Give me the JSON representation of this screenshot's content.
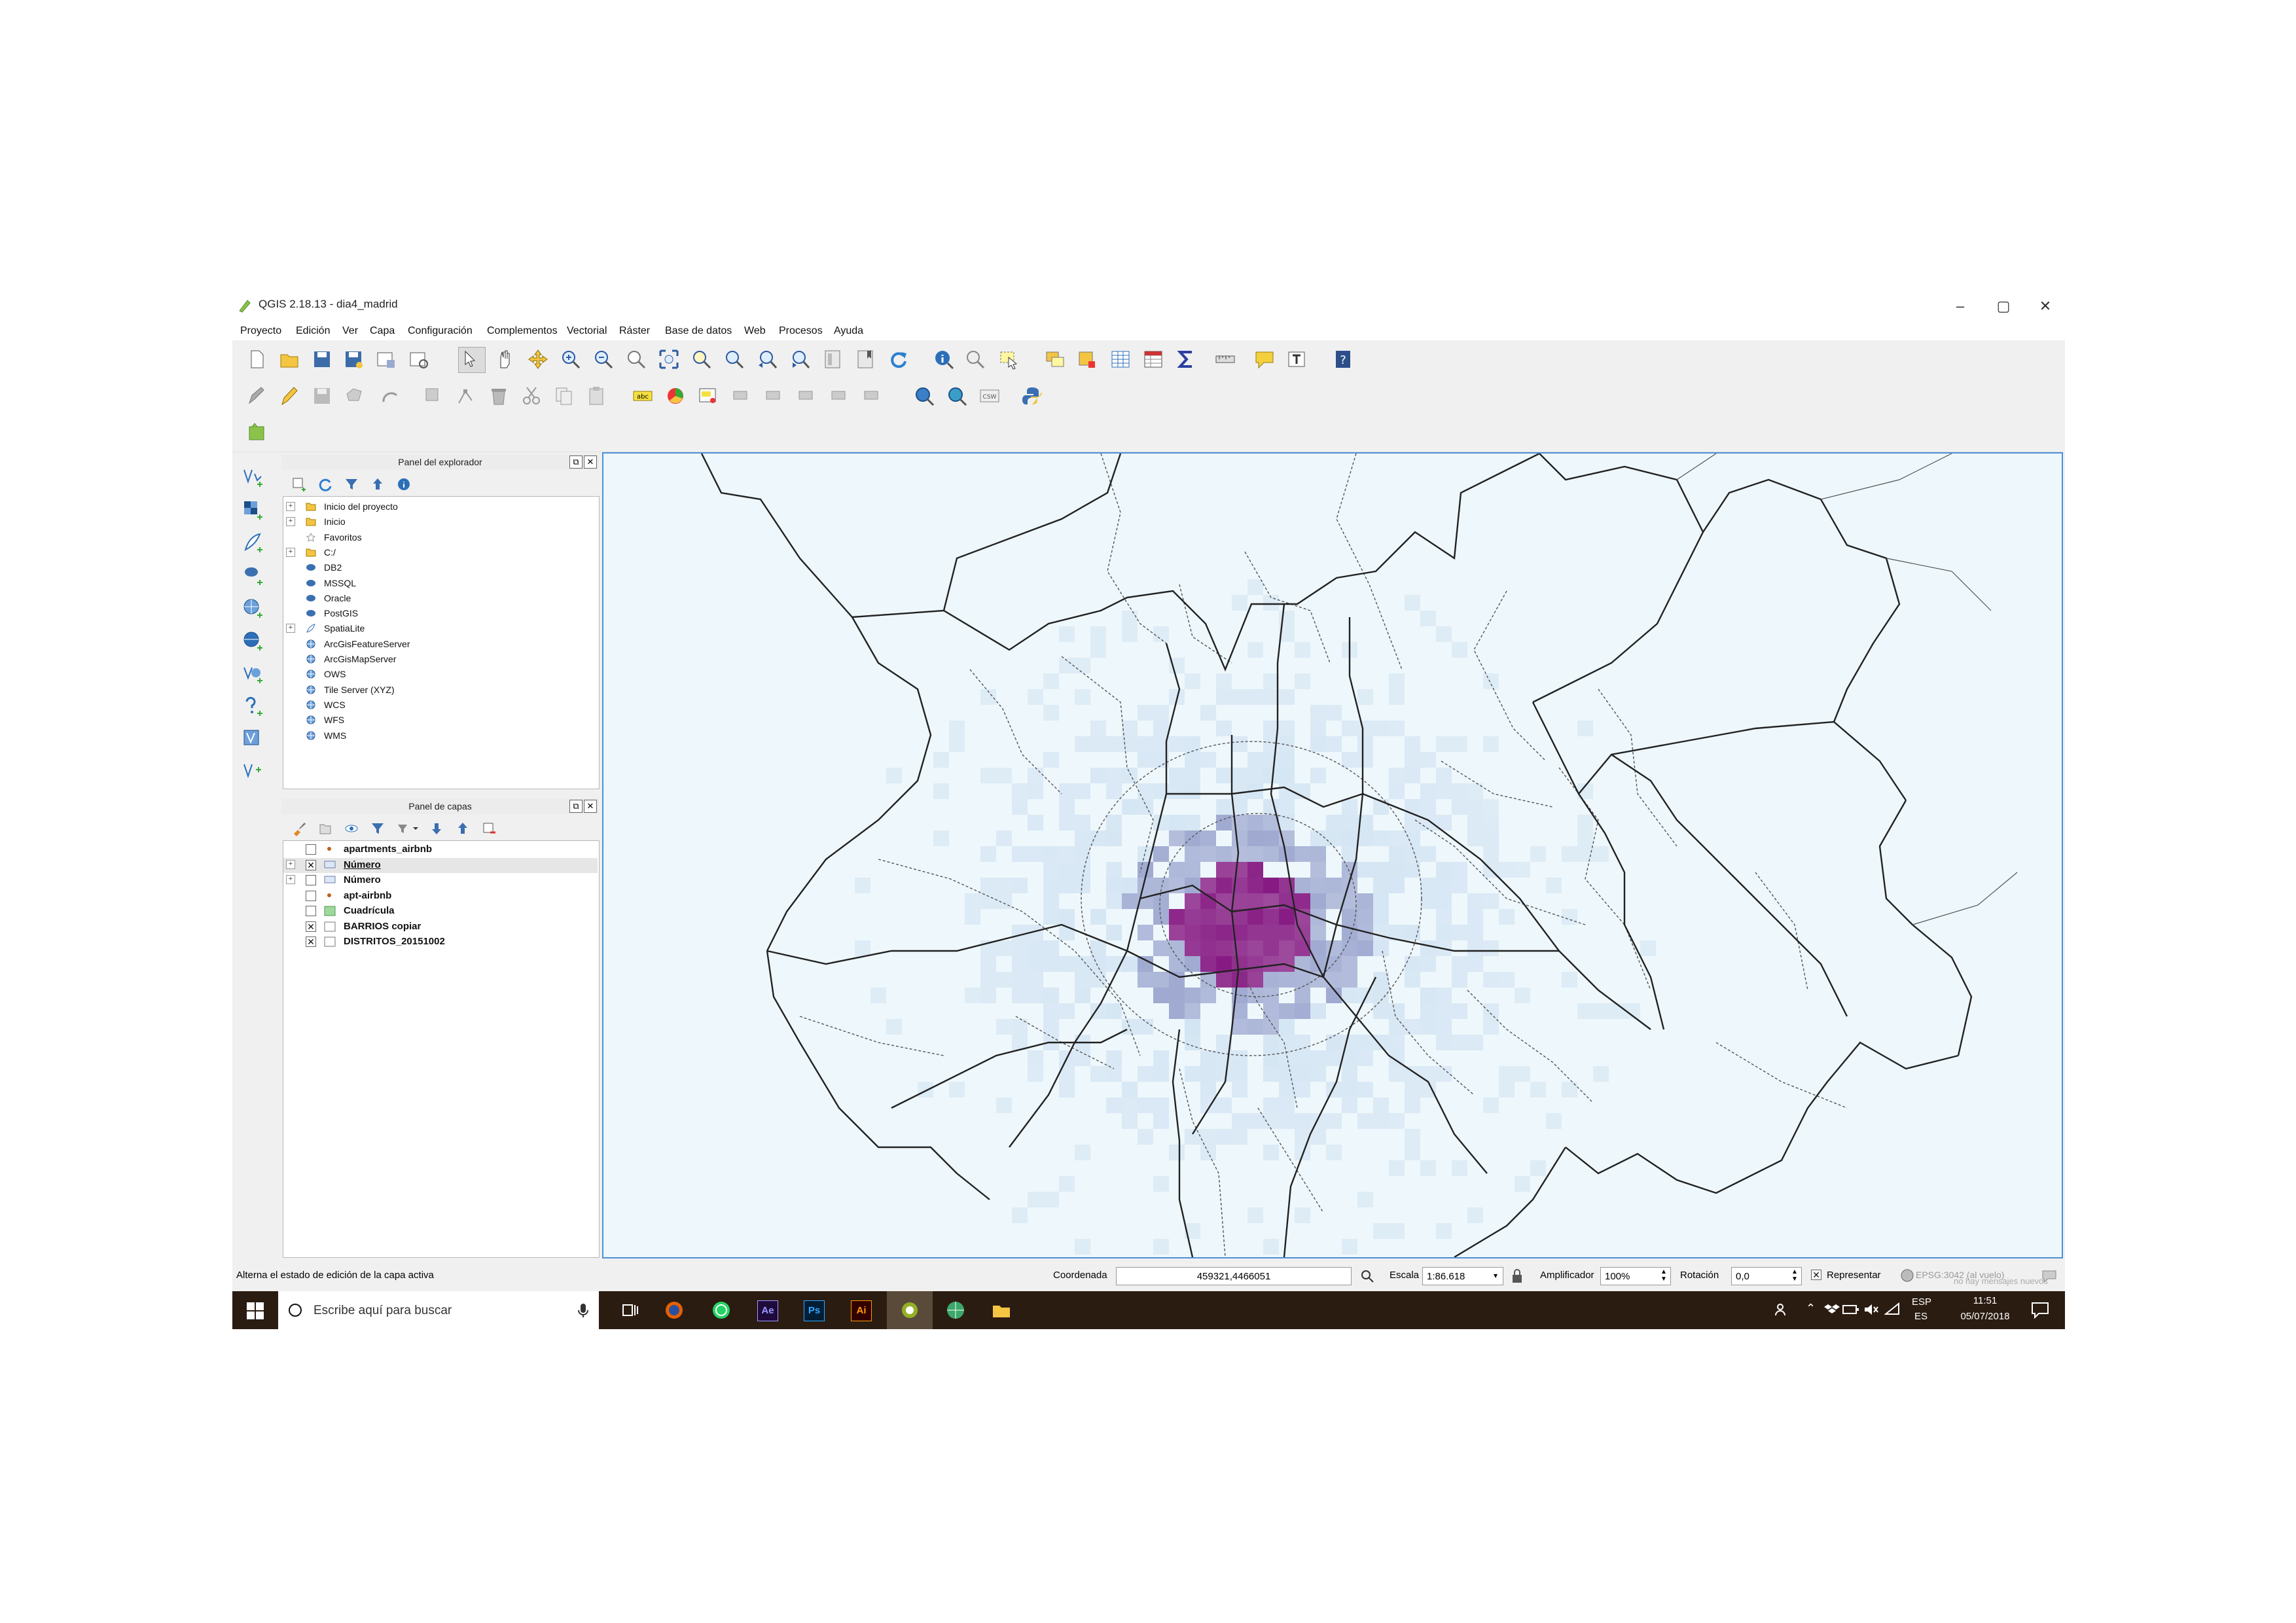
{
  "window": {
    "title": "QGIS 2.18.13 - dia4_madrid",
    "minimize": "–",
    "maximize": "▢",
    "close": "✕"
  },
  "menu": [
    "Proyecto",
    "Edición",
    "Ver",
    "Capa",
    "Configuración",
    "Complementos",
    "Vectorial",
    "Ráster",
    "Base de datos",
    "Web",
    "Procesos",
    "Ayuda"
  ],
  "browser_panel": {
    "title": "Panel del explorador",
    "items": [
      {
        "label": "Inicio del proyecto",
        "icon": "folder-icon"
      },
      {
        "label": "Inicio",
        "icon": "folder-icon"
      },
      {
        "label": "Favoritos",
        "icon": "star-icon"
      },
      {
        "label": "C:/",
        "icon": "folder-icon"
      },
      {
        "label": "DB2",
        "icon": "database-icon"
      },
      {
        "label": "MSSQL",
        "icon": "database-icon"
      },
      {
        "label": "Oracle",
        "icon": "database-icon"
      },
      {
        "label": "PostGIS",
        "icon": "database-icon"
      },
      {
        "label": "SpatiaLite",
        "icon": "feather-icon"
      },
      {
        "label": "ArcGisFeatureServer",
        "icon": "globe-icon"
      },
      {
        "label": "ArcGisMapServer",
        "icon": "globe-icon"
      },
      {
        "label": "OWS",
        "icon": "globe-icon"
      },
      {
        "label": "Tile Server (XYZ)",
        "icon": "globe-icon"
      },
      {
        "label": "WCS",
        "icon": "globe-icon"
      },
      {
        "label": "WFS",
        "icon": "globe-icon"
      },
      {
        "label": "WMS",
        "icon": "globe-icon"
      }
    ]
  },
  "layers_panel": {
    "title": "Panel de capas",
    "layers": [
      {
        "label": "apartments_airbnb",
        "checked": false,
        "icon": "point-icon",
        "underline": false
      },
      {
        "label": "Número",
        "checked": true,
        "icon": "raster-icon",
        "underline": true
      },
      {
        "label": "Número",
        "checked": false,
        "icon": "raster-icon",
        "underline": false
      },
      {
        "label": "apt-airbnb",
        "checked": false,
        "icon": "point-icon",
        "underline": false
      },
      {
        "label": "Cuadrícula",
        "checked": false,
        "icon": "polygon-icon",
        "underline": false
      },
      {
        "label": "BARRIOS copiar",
        "checked": true,
        "icon": "polygon-icon",
        "underline": false
      },
      {
        "label": "DISTRITOS_20151002",
        "checked": true,
        "icon": "polygon-icon",
        "underline": false
      }
    ]
  },
  "statusbar": {
    "message": "Alterna el estado de edición de la capa activa",
    "coord_label": "Coordenada",
    "coord_value": "459321,4466051",
    "scale_label": "Escala",
    "scale_value": "1:86.618",
    "magnifier_label": "Amplificador",
    "magnifier_value": "100%",
    "rotation_label": "Rotación",
    "rotation_value": "0,0",
    "render_label": "Representar",
    "crs_label": "EPSG:3042 (al vuelo)",
    "messages_label": "no hay mensajes nuevos"
  },
  "taskbar": {
    "search_placeholder": "Escribe aquí para buscar",
    "apps": [
      "Ae",
      "Ps",
      "Ai"
    ],
    "lang_top": "ESP",
    "lang_bottom": "ES",
    "time": "11:51",
    "date": "05/07/2018"
  },
  "colors": {
    "map_bg": "#eef7fb",
    "heat_low": "#c6dbef",
    "heat_mid": "#8c96c6",
    "heat_high": "#810f7c",
    "taskbar": "#2b1c12"
  }
}
